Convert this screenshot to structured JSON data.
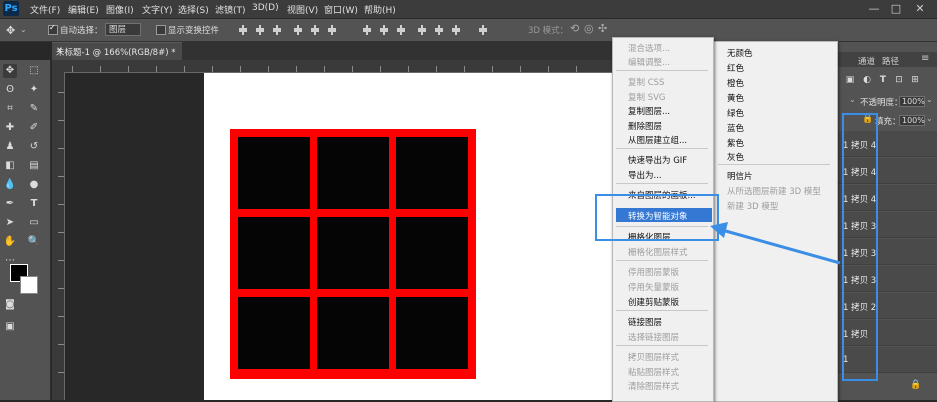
{
  "app": {
    "logo": "Ps"
  },
  "menubar": {
    "items": [
      "文件(F)",
      "编辑(E)",
      "图像(I)",
      "文字(Y)",
      "选择(S)",
      "滤镜(T)",
      "3D(D)",
      "视图(V)",
      "窗口(W)",
      "帮助(H)"
    ],
    "window_controls": [
      "—",
      "□",
      "✕"
    ]
  },
  "options_bar": {
    "auto_select_label": "自动选择：",
    "auto_select_value": "图层",
    "show_transform_label": "显示变换控件",
    "mode_3d_label": "3D 模式："
  },
  "document": {
    "tab_title": "未标题-1 @ 166%(RGB/8#) *",
    "close": "✕"
  },
  "colors": {
    "grid_border": "#ff0000",
    "cell_fill": "#050505",
    "highlight": "#3478d4",
    "annotation": "#3a8ee6"
  },
  "panel": {
    "tabs": [
      "通道",
      "路径"
    ],
    "opacity_label": "不透明度：",
    "opacity_value": "100%",
    "fill_label": "填充：",
    "fill_value": "100%",
    "layers": [
      "1 拷贝 4",
      "1 拷贝 4",
      "1 拷贝 4",
      "1 拷贝 3",
      "1 拷贝 3",
      "1 拷贝 3",
      "1 拷贝 2",
      "1 拷贝",
      "1"
    ]
  },
  "context_menu": {
    "items": [
      {
        "label": "混合选项...",
        "disabled": true
      },
      {
        "label": "编辑调整...",
        "disabled": true
      },
      {
        "label": "复制 CSS",
        "disabled": true
      },
      {
        "label": "复制 SVG",
        "disabled": true
      },
      {
        "label": "复制图层...",
        "disabled": false
      },
      {
        "label": "删除图层",
        "disabled": false
      },
      {
        "label": "从图层建立组...",
        "disabled": false
      },
      {
        "label": "快速导出为 GIF",
        "disabled": false
      },
      {
        "label": "导出为...",
        "disabled": false
      },
      {
        "label": "来自图层的画板...",
        "disabled": false
      },
      {
        "label": "转换为智能对象",
        "disabled": false,
        "highlighted": true
      },
      {
        "label": "栅格化图层",
        "disabled": false
      },
      {
        "label": "栅格化图层样式",
        "disabled": true
      },
      {
        "label": "停用图层蒙版",
        "disabled": true
      },
      {
        "label": "停用矢量蒙版",
        "disabled": true
      },
      {
        "label": "创建剪贴蒙版",
        "disabled": false
      },
      {
        "label": "链接图层",
        "disabled": false
      },
      {
        "label": "选择链接图层",
        "disabled": true
      },
      {
        "label": "拷贝图层样式",
        "disabled": true
      },
      {
        "label": "粘贴图层样式",
        "disabled": true
      },
      {
        "label": "清除图层样式",
        "disabled": true
      }
    ]
  },
  "color_menu": {
    "items": [
      {
        "label": "无颜色",
        "disabled": false
      },
      {
        "label": "红色",
        "disabled": false
      },
      {
        "label": "橙色",
        "disabled": false
      },
      {
        "label": "黄色",
        "disabled": false
      },
      {
        "label": "绿色",
        "disabled": false
      },
      {
        "label": "蓝色",
        "disabled": false
      },
      {
        "label": "紫色",
        "disabled": false
      },
      {
        "label": "灰色",
        "disabled": false
      },
      {
        "label": "明信片",
        "disabled": false
      },
      {
        "label": "从所选图层新建 3D 模型",
        "disabled": true
      },
      {
        "label": "新建 3D 模型",
        "disabled": true
      }
    ]
  }
}
